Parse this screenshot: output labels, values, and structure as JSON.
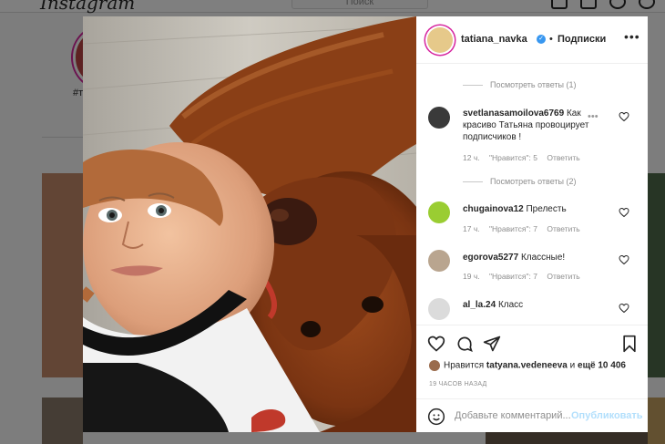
{
  "background": {
    "logo": "Instagram",
    "search_placeholder": "Поиск",
    "hashtag": "#т"
  },
  "post": {
    "author": "tatiana_navka",
    "separator": "•",
    "follow_label": "Подписки",
    "more_label": "•••"
  },
  "comments": {
    "view_replies_1": "Посмотреть ответы (1)",
    "view_replies_2": "Посмотреть ответы (2)",
    "items": [
      {
        "user": "svetlanasamoilova6769",
        "text": "Как красиво Татьяна провоцирует подписчиков !",
        "time": "12 ч.",
        "likes": "\"Нравится\": 5",
        "reply": "Ответить",
        "avatar_color": "#3a3a3a"
      },
      {
        "user": "chugainova12",
        "text": "Прелесть",
        "time": "17 ч.",
        "likes": "\"Нравится\": 7",
        "reply": "Ответить",
        "avatar_color": "#9acd32"
      },
      {
        "user": "egorova5277",
        "text": "Классные!",
        "time": "19 ч.",
        "likes": "\"Нравится\": 7",
        "reply": "Ответить",
        "avatar_color": "#b9a58f"
      },
      {
        "user": "al_la.24",
        "text": "Класс",
        "avatar_color": "#dbdbdb"
      }
    ]
  },
  "likes": {
    "prefix": "Нравится",
    "user": "tatyana.vedeneeva",
    "connector": "и",
    "count_text": "ещё 10 406"
  },
  "post_time": "19 ЧАСОВ НАЗАД",
  "add_comment": {
    "placeholder": "Добавьте комментарий...",
    "publish_label": "Опубликовать"
  },
  "colors": {
    "verified": "#3897f0",
    "story_ring": "#d6249f",
    "publish_disabled": "#b2dffc",
    "muted_text": "#8e8e8e"
  },
  "icons": [
    "home-icon",
    "explore-icon",
    "compass-icon",
    "heart-icon",
    "verified-icon",
    "heart-outline-icon",
    "comment-icon",
    "share-icon",
    "bookmark-icon",
    "smile-icon"
  ]
}
